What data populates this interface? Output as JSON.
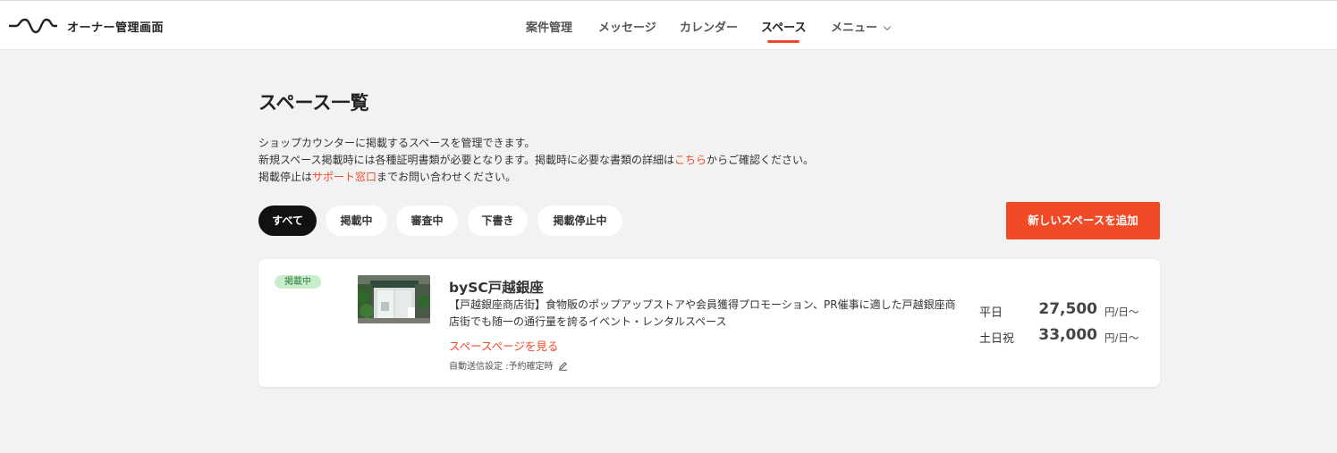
{
  "header": {
    "logo_text": "オーナー管理画面",
    "nav": [
      {
        "label": "案件管理"
      },
      {
        "label": "メッセージ"
      },
      {
        "label": "カレンダー"
      },
      {
        "label": "スペース"
      },
      {
        "label": "メニュー"
      }
    ],
    "active_nav": "スペース"
  },
  "page": {
    "title": "スペース一覧",
    "desc_line1": "ショップカウンターに掲載するスペースを管理できます。",
    "desc_line2_a": "新規スペース掲載時には各種証明書類が必要となります。掲載時に必要な書類の詳細は",
    "desc_line2_link": "こちら",
    "desc_line2_b": "からご確認ください。",
    "desc_line3_a": "掲載停止は",
    "desc_line3_link": "サポート窓口",
    "desc_line3_b": "までお問い合わせください。"
  },
  "filters": [
    {
      "label": "すべて"
    },
    {
      "label": "掲載中"
    },
    {
      "label": "審査中"
    },
    {
      "label": "下書き"
    },
    {
      "label": "掲載停止中"
    }
  ],
  "active_filter": "すべて",
  "add_button": "新しいスペースを追加",
  "space": {
    "status": "掲載中",
    "name": "bySC戸越銀座",
    "description": "【戸越銀座商店街】食物販のポップアップストアや会員獲得プロモーション、PR催事に適した戸越銀座商店街でも随一の通行量を誇るイベント・レンタルスペース",
    "link": "スペースページを見る",
    "auto_send": "自動送信設定 :予約確定時",
    "prices": [
      {
        "label": "平日",
        "value": "27,500",
        "unit": "円/日〜"
      },
      {
        "label": "土日祝",
        "value": "33,000",
        "unit": "円/日〜"
      }
    ]
  },
  "colors": {
    "accent": "#f04a27",
    "badge_bg": "#c9eccd",
    "badge_text": "#2e7d3a"
  }
}
